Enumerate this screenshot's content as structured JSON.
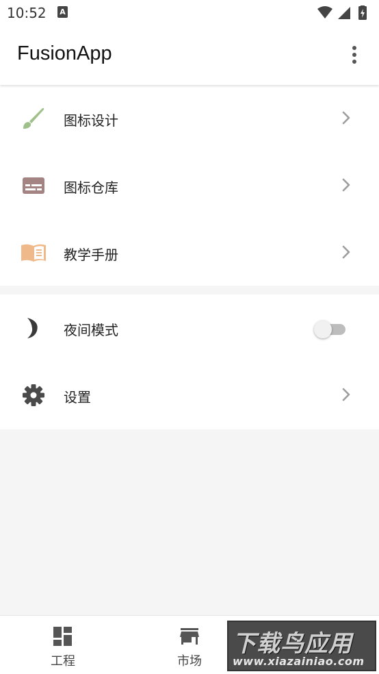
{
  "status_bar": {
    "time": "10:52",
    "notification_badge": "A",
    "icons": [
      "wifi-icon",
      "signal-icon",
      "battery-charging-icon"
    ]
  },
  "app_bar": {
    "title": "FusionApp",
    "more_icon": "more-vert-icon"
  },
  "menu": {
    "section1": [
      {
        "label": "图标设计",
        "icon": "brush-icon",
        "icon_color": "#9fc08a"
      },
      {
        "label": "图标仓库",
        "icon": "subtitles-icon",
        "icon_color": "#a48383"
      },
      {
        "label": "教学手册",
        "icon": "book-open-icon",
        "icon_color": "#f0b98a"
      }
    ],
    "section2": [
      {
        "label": "夜间模式",
        "icon": "moon-icon",
        "icon_color": "#3a3a3a",
        "control": "toggle",
        "checked": false
      },
      {
        "label": "设置",
        "icon": "gear-icon",
        "icon_color": "#4a4a4a"
      }
    ]
  },
  "bottom_nav": {
    "items": [
      {
        "label": "工程",
        "icon": "dashboard-icon"
      },
      {
        "label": "市场",
        "icon": "store-icon"
      },
      {
        "label": "",
        "icon": "watermark-covered"
      }
    ]
  },
  "watermark": {
    "title": "下载鸟应用",
    "url": "www.xiazainiao.com"
  },
  "colors": {
    "background": "#f5f5f5",
    "surface": "#ffffff",
    "chevron": "#9e9e9e",
    "toggle_track": "#bdbdbd"
  }
}
